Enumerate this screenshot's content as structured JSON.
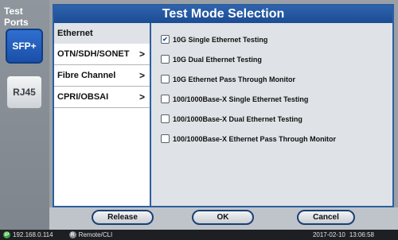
{
  "sidebar": {
    "title": "Test Ports",
    "ports": [
      {
        "label": "SFP+"
      },
      {
        "label": "RJ45"
      }
    ]
  },
  "panel": {
    "title": "Test Mode Selection"
  },
  "categories": [
    {
      "label": "Ethernet",
      "chevron": ""
    },
    {
      "label": "OTN/SDH/SONET",
      "chevron": ">"
    },
    {
      "label": "Fibre Channel",
      "chevron": ">"
    },
    {
      "label": "CPRI/OBSAI",
      "chevron": ">"
    }
  ],
  "options": [
    {
      "label": "10G Single Ethernet Testing",
      "checked": true
    },
    {
      "label": "10G Dual Ethernet Testing",
      "checked": false
    },
    {
      "label": "10G Ethernet Pass Through Monitor",
      "checked": false
    },
    {
      "label": "100/1000Base-X Single Ethernet Testing",
      "checked": false
    },
    {
      "label": "100/1000Base-X Dual Ethernet Testing",
      "checked": false
    },
    {
      "label": "100/1000Base-X Ethernet Pass Through Monitor",
      "checked": false
    }
  ],
  "footer": {
    "release": "Release",
    "ok": "OK",
    "cancel": "Cancel"
  },
  "status": {
    "ip_icon": "IP",
    "ip": "192.168.0.114",
    "remote_icon": "R",
    "remote": "Remote/CLI",
    "date": "2017-02-10",
    "time": "13:06:58",
    "colors": {
      "ip": "#39a845",
      "remote": "#8a8f95"
    }
  }
}
